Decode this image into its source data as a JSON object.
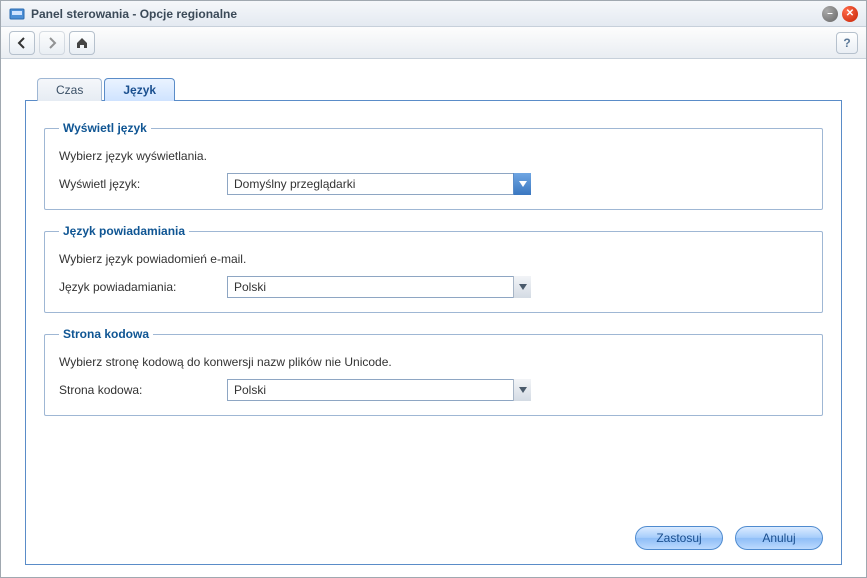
{
  "window": {
    "title": "Panel sterowania - Opcje regionalne"
  },
  "toolbar": {
    "help_label": "?"
  },
  "tabs": [
    {
      "label": "Czas",
      "active": false
    },
    {
      "label": "Język",
      "active": true
    }
  ],
  "groups": {
    "display_lang": {
      "legend": "Wyświetl język",
      "desc": "Wybierz język wyświetlania.",
      "field_label": "Wyświetl język:",
      "value": "Domyślny przeglądarki"
    },
    "notify_lang": {
      "legend": "Język powiadamiania",
      "desc": "Wybierz język powiadomień e-mail.",
      "field_label": "Język powiadamiania:",
      "value": "Polski"
    },
    "codepage": {
      "legend": "Strona kodowa",
      "desc": "Wybierz stronę kodową do konwersji nazw plików nie Unicode.",
      "field_label": "Strona kodowa:",
      "value": "Polski"
    }
  },
  "buttons": {
    "apply": "Zastosuj",
    "cancel": "Anuluj"
  }
}
